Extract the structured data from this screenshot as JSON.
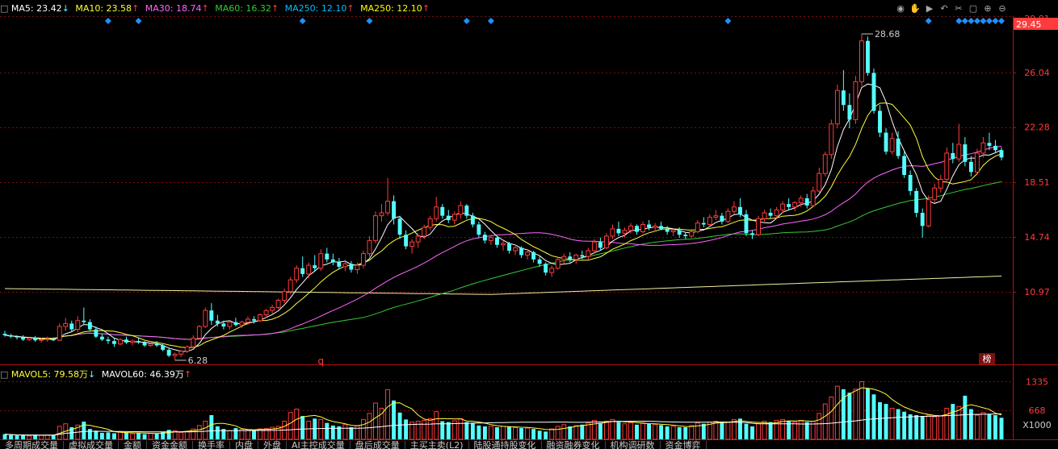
{
  "ma_legend": [
    {
      "label": "MA5: 23.42",
      "arrow": "↓",
      "color": "#ffffff"
    },
    {
      "label": "MA10: 23.58",
      "arrow": "↑",
      "color": "#ffff3c"
    },
    {
      "label": "MA30: 18.74",
      "arrow": "↑",
      "color": "#ff66ff"
    },
    {
      "label": "MA60: 16.32",
      "arrow": "↑",
      "color": "#33cc33"
    },
    {
      "label": "MA250: 12.10",
      "arrow": "↑",
      "color": "#00bfff"
    },
    {
      "label": "MA250: 12.10",
      "arrow": "↑",
      "color": "#ffff00"
    }
  ],
  "vol_legend": [
    {
      "label": "MAVOL5: 79.58万",
      "arrow": "↓",
      "color": "#ffff3c"
    },
    {
      "label": "MAVOL60: 46.39万",
      "arrow": "↑",
      "color": "#ffffff"
    }
  ],
  "price_axis_labels": [
    "26.04",
    "22.28",
    "18.51",
    "14.74",
    "10.97"
  ],
  "current_price_label": "29.45",
  "partial_top_label": "29.81",
  "volume_axis_labels": [
    "1335",
    "668"
  ],
  "volume_unit": "X1000",
  "annotations": {
    "high": "28.68",
    "low": "6.28",
    "marker": "q",
    "badge": "榜"
  },
  "toolbar_icons": [
    "eye-icon",
    "hand-icon",
    "play-icon",
    "undo-icon",
    "cut-icon",
    "lock-icon",
    "add-icon",
    "remove-icon"
  ],
  "tabs": [
    "多周期成交量",
    "虚拟成交量",
    "金额",
    "资金金额",
    "换手率",
    "内盘",
    "外盘",
    "AI主控成交量",
    "盘后成交量",
    "主买主卖(L2)",
    "陆股通持股变化",
    "融资融券变化",
    "机构调研数",
    "资金博弈"
  ],
  "colors": {
    "up": "#ff3b3b",
    "down": "#54ffff",
    "grid": "#7a1010",
    "axis": "#b01010"
  },
  "chart_data": [
    {
      "type": "candlestick",
      "title": "",
      "yticks": [
        10.97,
        14.74,
        18.51,
        22.28,
        26.04
      ],
      "ylim": [
        6.0,
        29.9
      ],
      "grid": true,
      "high_label": 28.68,
      "low_label": 6.28,
      "candles": [
        [
          8.1,
          8.3,
          7.9,
          8.0
        ],
        [
          8.0,
          8.1,
          7.8,
          7.9
        ],
        [
          7.9,
          8.0,
          7.7,
          7.85
        ],
        [
          7.85,
          8.0,
          7.6,
          7.7
        ],
        [
          7.7,
          7.9,
          7.6,
          7.8
        ],
        [
          7.8,
          7.95,
          7.55,
          7.65
        ],
        [
          7.65,
          7.8,
          7.5,
          7.7
        ],
        [
          7.7,
          7.9,
          7.55,
          7.75
        ],
        [
          7.75,
          7.85,
          7.6,
          7.65
        ],
        [
          7.65,
          8.8,
          7.6,
          8.6
        ],
        [
          8.6,
          9.2,
          8.3,
          8.8
        ],
        [
          8.8,
          9.0,
          8.2,
          8.4
        ],
        [
          8.4,
          9.3,
          8.2,
          9.0
        ],
        [
          9.0,
          9.9,
          8.7,
          8.9
        ],
        [
          8.9,
          9.1,
          8.3,
          8.4
        ],
        [
          8.4,
          8.6,
          7.8,
          7.9
        ],
        [
          7.9,
          8.1,
          7.6,
          7.7
        ],
        [
          7.7,
          7.9,
          7.4,
          7.6
        ],
        [
          7.6,
          7.8,
          7.2,
          7.4
        ],
        [
          7.4,
          7.8,
          7.3,
          7.7
        ],
        [
          7.7,
          7.9,
          7.4,
          7.5
        ],
        [
          7.5,
          7.7,
          7.3,
          7.6
        ],
        [
          7.6,
          7.8,
          7.4,
          7.5
        ],
        [
          7.5,
          7.6,
          7.2,
          7.3
        ],
        [
          7.3,
          7.5,
          7.2,
          7.4
        ],
        [
          7.4,
          7.6,
          7.2,
          7.3
        ],
        [
          7.3,
          7.4,
          6.9,
          7.0
        ],
        [
          7.0,
          7.1,
          6.5,
          6.6
        ],
        [
          6.6,
          6.8,
          6.28,
          6.7
        ],
        [
          6.7,
          7.0,
          6.5,
          6.9
        ],
        [
          6.9,
          7.3,
          6.8,
          7.2
        ],
        [
          7.2,
          8.0,
          7.1,
          7.8
        ],
        [
          7.8,
          8.7,
          7.7,
          8.6
        ],
        [
          8.6,
          9.9,
          8.5,
          9.7
        ],
        [
          9.7,
          10.2,
          8.7,
          9.0
        ],
        [
          9.0,
          9.4,
          8.6,
          8.8
        ],
        [
          8.8,
          9.0,
          8.4,
          8.6
        ],
        [
          8.6,
          9.0,
          8.4,
          8.9
        ],
        [
          8.9,
          9.2,
          8.6,
          8.7
        ],
        [
          8.7,
          9.0,
          8.5,
          8.9
        ],
        [
          8.9,
          9.3,
          8.7,
          9.1
        ],
        [
          9.1,
          9.3,
          8.8,
          9.0
        ],
        [
          9.0,
          9.5,
          8.9,
          9.4
        ],
        [
          9.4,
          9.8,
          9.2,
          9.7
        ],
        [
          9.7,
          10.1,
          9.5,
          9.9
        ],
        [
          9.9,
          10.5,
          9.8,
          10.4
        ],
        [
          10.4,
          11.2,
          10.2,
          11.0
        ],
        [
          11.0,
          12.0,
          10.8,
          11.8
        ],
        [
          11.8,
          12.8,
          11.6,
          12.6
        ],
        [
          12.6,
          13.4,
          12.0,
          12.2
        ],
        [
          12.2,
          13.0,
          11.9,
          12.8
        ],
        [
          12.8,
          13.5,
          12.4,
          12.6
        ],
        [
          12.6,
          13.9,
          12.4,
          13.6
        ],
        [
          13.6,
          14.0,
          13.0,
          13.2
        ],
        [
          13.2,
          13.6,
          12.8,
          13.0
        ],
        [
          13.0,
          13.3,
          12.5,
          12.7
        ],
        [
          12.7,
          13.2,
          12.4,
          12.9
        ],
        [
          12.9,
          13.1,
          12.3,
          12.5
        ],
        [
          12.5,
          13.0,
          12.2,
          12.8
        ],
        [
          12.8,
          13.8,
          12.6,
          13.6
        ],
        [
          13.6,
          14.8,
          13.4,
          14.5
        ],
        [
          14.5,
          16.5,
          14.3,
          16.2
        ],
        [
          16.2,
          17.0,
          15.8,
          16.4
        ],
        [
          16.4,
          18.8,
          16.2,
          17.2
        ],
        [
          17.2,
          17.6,
          15.6,
          16.0
        ],
        [
          16.0,
          16.2,
          14.6,
          14.9
        ],
        [
          14.9,
          15.2,
          13.9,
          14.1
        ],
        [
          14.1,
          14.6,
          13.6,
          14.4
        ],
        [
          14.4,
          15.0,
          14.0,
          14.8
        ],
        [
          14.8,
          15.6,
          14.6,
          15.4
        ],
        [
          15.4,
          16.2,
          15.2,
          16.0
        ],
        [
          16.0,
          17.5,
          15.8,
          16.8
        ],
        [
          16.8,
          17.0,
          16.0,
          16.2
        ],
        [
          16.2,
          16.6,
          15.7,
          15.9
        ],
        [
          15.9,
          16.5,
          15.6,
          16.3
        ],
        [
          16.3,
          17.2,
          16.0,
          16.9
        ],
        [
          16.9,
          17.0,
          16.0,
          16.2
        ],
        [
          16.2,
          16.4,
          15.4,
          15.6
        ],
        [
          15.6,
          15.8,
          14.7,
          14.9
        ],
        [
          14.9,
          15.1,
          14.3,
          14.5
        ],
        [
          14.5,
          14.9,
          14.2,
          14.7
        ],
        [
          14.7,
          14.8,
          14.0,
          14.2
        ],
        [
          14.2,
          14.5,
          13.8,
          14.3
        ],
        [
          14.3,
          14.4,
          13.6,
          13.8
        ],
        [
          13.8,
          14.2,
          13.5,
          14.0
        ],
        [
          14.0,
          14.1,
          13.3,
          13.5
        ],
        [
          13.5,
          13.9,
          13.2,
          13.7
        ],
        [
          13.7,
          13.8,
          13.0,
          13.2
        ],
        [
          13.2,
          13.4,
          12.7,
          12.9
        ],
        [
          12.9,
          13.0,
          12.1,
          12.3
        ],
        [
          12.3,
          12.8,
          12.0,
          12.6
        ],
        [
          12.6,
          13.4,
          12.5,
          13.2
        ],
        [
          13.2,
          13.6,
          12.9,
          13.4
        ],
        [
          13.4,
          13.7,
          13.0,
          13.2
        ],
        [
          13.2,
          13.6,
          12.9,
          13.5
        ],
        [
          13.5,
          13.8,
          13.2,
          13.4
        ],
        [
          13.4,
          14.0,
          13.2,
          13.8
        ],
        [
          13.8,
          14.6,
          13.6,
          14.4
        ],
        [
          14.4,
          14.7,
          13.8,
          14.0
        ],
        [
          14.0,
          15.0,
          13.9,
          14.8
        ],
        [
          14.8,
          15.6,
          14.6,
          15.3
        ],
        [
          15.3,
          15.8,
          14.8,
          15.0
        ],
        [
          15.0,
          15.4,
          14.7,
          15.2
        ],
        [
          15.2,
          15.7,
          15.0,
          15.5
        ],
        [
          15.5,
          15.6,
          14.9,
          15.1
        ],
        [
          15.1,
          15.8,
          15.0,
          15.6
        ],
        [
          15.6,
          15.9,
          15.2,
          15.4
        ],
        [
          15.4,
          15.7,
          15.1,
          15.5
        ],
        [
          15.5,
          15.8,
          15.2,
          15.3
        ],
        [
          15.3,
          15.5,
          14.9,
          15.1
        ],
        [
          15.1,
          15.3,
          14.8,
          15.2
        ],
        [
          15.2,
          15.4,
          14.7,
          14.9
        ],
        [
          14.9,
          15.1,
          14.6,
          14.8
        ],
        [
          14.8,
          15.3,
          14.7,
          15.1
        ],
        [
          15.1,
          15.9,
          15.0,
          15.7
        ],
        [
          15.7,
          16.1,
          15.4,
          15.6
        ],
        [
          15.6,
          16.3,
          15.5,
          16.1
        ],
        [
          16.1,
          16.6,
          15.9,
          16.2
        ],
        [
          16.2,
          16.4,
          15.6,
          15.8
        ],
        [
          15.8,
          16.7,
          15.7,
          16.5
        ],
        [
          16.5,
          17.2,
          16.3,
          16.8
        ],
        [
          16.8,
          17.4,
          16.1,
          16.3
        ],
        [
          16.3,
          16.6,
          14.8,
          15.0
        ],
        [
          15.0,
          15.2,
          14.6,
          14.9
        ],
        [
          14.9,
          16.2,
          14.8,
          16.0
        ],
        [
          16.0,
          16.6,
          15.8,
          16.4
        ],
        [
          16.4,
          16.7,
          16.0,
          16.2
        ],
        [
          16.2,
          16.8,
          16.0,
          16.6
        ],
        [
          16.6,
          17.2,
          16.4,
          17.0
        ],
        [
          17.0,
          17.4,
          16.6,
          16.8
        ],
        [
          16.8,
          17.2,
          16.5,
          17.1
        ],
        [
          17.1,
          17.6,
          16.8,
          17.4
        ],
        [
          17.4,
          17.7,
          16.7,
          16.9
        ],
        [
          16.9,
          18.2,
          16.8,
          17.9
        ],
        [
          17.9,
          19.5,
          17.7,
          19.1
        ],
        [
          19.1,
          20.6,
          18.9,
          20.4
        ],
        [
          20.4,
          22.8,
          20.1,
          22.5
        ],
        [
          22.5,
          25.2,
          22.2,
          24.8
        ],
        [
          24.8,
          26.2,
          23.4,
          23.8
        ],
        [
          23.8,
          24.6,
          22.2,
          22.8
        ],
        [
          22.8,
          25.8,
          22.5,
          25.4
        ],
        [
          25.4,
          28.68,
          25.1,
          28.2
        ],
        [
          28.2,
          28.5,
          25.8,
          26.0
        ],
        [
          26.0,
          26.3,
          23.2,
          23.4
        ],
        [
          23.4,
          23.8,
          21.6,
          21.9
        ],
        [
          21.9,
          22.2,
          20.4,
          20.6
        ],
        [
          20.6,
          21.9,
          20.4,
          21.5
        ],
        [
          21.5,
          22.0,
          20.1,
          20.3
        ],
        [
          20.3,
          20.6,
          18.8,
          19.0
        ],
        [
          19.0,
          19.3,
          17.6,
          17.9
        ],
        [
          17.9,
          18.1,
          16.1,
          16.4
        ],
        [
          16.4,
          16.7,
          14.7,
          15.5
        ],
        [
          15.5,
          17.6,
          15.4,
          17.3
        ],
        [
          17.3,
          18.4,
          17.1,
          18.1
        ],
        [
          18.1,
          19.0,
          17.8,
          18.7
        ],
        [
          18.7,
          20.9,
          18.5,
          20.5
        ],
        [
          20.5,
          21.2,
          19.8,
          20.1
        ],
        [
          20.1,
          22.5,
          19.9,
          21.1
        ],
        [
          21.1,
          21.6,
          19.6,
          19.9
        ],
        [
          19.9,
          20.3,
          18.9,
          19.2
        ],
        [
          19.2,
          20.8,
          19.0,
          20.5
        ],
        [
          20.5,
          21.6,
          20.2,
          21.2
        ],
        [
          21.2,
          21.9,
          20.7,
          21.0
        ],
        [
          21.0,
          21.4,
          20.5,
          20.7
        ],
        [
          20.7,
          20.9,
          20.0,
          20.2
        ]
      ],
      "series": [
        {
          "name": "MA5",
          "color": "#ffffff",
          "value": 23.42
        },
        {
          "name": "MA10",
          "color": "#ffff3c",
          "value": 23.58
        },
        {
          "name": "MA30",
          "color": "#ff66ff",
          "value": 18.74
        },
        {
          "name": "MA60",
          "color": "#33cc33",
          "value": 16.32
        },
        {
          "name": "MA250",
          "color": "#ffff00",
          "value": 12.1
        }
      ]
    },
    {
      "type": "bar",
      "title": "",
      "unit": "X1000",
      "yticks": [
        668,
        1335
      ],
      "ylim": [
        0,
        1400
      ],
      "mavol_series": [
        {
          "name": "MAVOL5",
          "value": "79.58万"
        },
        {
          "name": "MAVOL60",
          "value": "46.39万"
        }
      ],
      "values": [
        120,
        100,
        90,
        95,
        80,
        110,
        95,
        100,
        90,
        300,
        360,
        280,
        330,
        410,
        240,
        200,
        150,
        160,
        140,
        170,
        160,
        130,
        150,
        120,
        140,
        130,
        170,
        220,
        200,
        160,
        180,
        240,
        320,
        420,
        560,
        300,
        240,
        200,
        260,
        230,
        220,
        200,
        240,
        250,
        280,
        300,
        420,
        620,
        700,
        540,
        420,
        480,
        460,
        380,
        320,
        300,
        340,
        280,
        320,
        460,
        600,
        840,
        720,
        1150,
        900,
        620,
        460,
        400,
        420,
        440,
        480,
        640,
        420,
        400,
        430,
        480,
        400,
        380,
        320,
        300,
        300,
        280,
        300,
        290,
        270,
        260,
        260,
        240,
        200,
        180,
        240,
        300,
        340,
        300,
        320,
        340,
        380,
        440,
        380,
        420,
        460,
        400,
        360,
        380,
        340,
        380,
        360,
        340,
        330,
        300,
        300,
        280,
        280,
        320,
        380,
        360,
        400,
        420,
        380,
        400,
        460,
        480,
        360,
        300,
        360,
        420,
        400,
        440,
        460,
        420,
        400,
        440,
        400,
        420,
        600,
        820,
        980,
        1230,
        1160,
        1080,
        1160,
        1335,
        1180,
        1040,
        860,
        820,
        720,
        700,
        640,
        580,
        560,
        540,
        560,
        520,
        540,
        720,
        820,
        760,
        1010,
        700,
        560,
        620,
        580,
        560,
        500
      ]
    }
  ]
}
